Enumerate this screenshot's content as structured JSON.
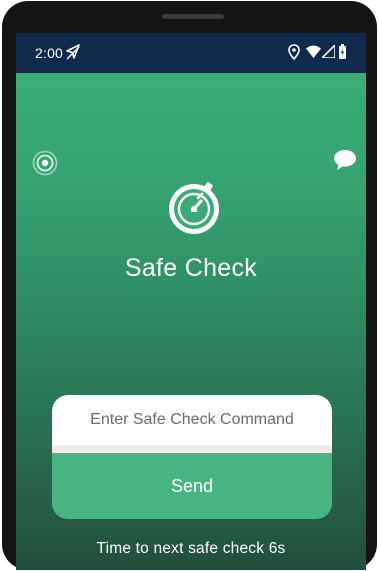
{
  "status_bar": {
    "time": "2:00",
    "icons": [
      "navigation-arrow-icon",
      "location-pin-icon",
      "wifi-icon",
      "signal-icon",
      "battery-icon"
    ]
  },
  "header": {
    "left_icon": "radar-icon",
    "right_icon": "chat-bubble-icon"
  },
  "app": {
    "logo_icon": "safe-check-timer-icon",
    "title": "Safe Check"
  },
  "command_form": {
    "input_value": "",
    "input_placeholder": "Enter Safe Check Command",
    "send_label": "Send"
  },
  "footer": {
    "timer_text": "Time to next safe check 6s"
  },
  "colors": {
    "status_bar": "#0f2a4d",
    "gradient_top": "#3bb07a",
    "gradient_bottom": "#224f3d",
    "send_button": "#47b482"
  }
}
